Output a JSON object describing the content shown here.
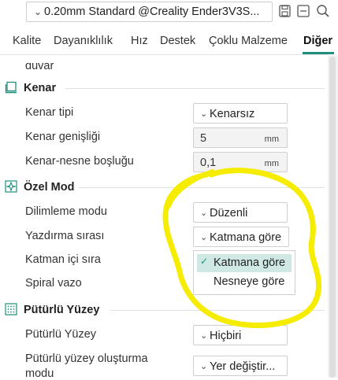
{
  "profile": {
    "preset": "0.20mm Standard @Creality Ender3V3S..."
  },
  "icons": {
    "save": "save-icon",
    "compare": "compare-icon",
    "search": "search-icon",
    "edge": "edge-section-icon",
    "special": "special-mode-icon",
    "fuzzy": "fuzzy-skin-icon"
  },
  "tabs": [
    {
      "label": "Kalite"
    },
    {
      "label": "Dayanıklılık"
    },
    {
      "label": "Hız"
    },
    {
      "label": "Destek"
    },
    {
      "label": "Çoklu Malzeme"
    },
    {
      "label": "Diğer",
      "active": true
    }
  ],
  "cutoff_label": "duvar",
  "sections": {
    "edge": {
      "title": "Kenar",
      "rows": [
        {
          "label": "Kenar tipi",
          "value": "Kenarsız"
        },
        {
          "label": "Kenar genişliği",
          "value": "5",
          "unit": "mm"
        },
        {
          "label": "Kenar-nesne boşluğu",
          "value": "0,1",
          "unit": "mm"
        }
      ]
    },
    "special": {
      "title": "Özel Mod",
      "rows": [
        {
          "label": "Dilimleme modu",
          "value": "Düzenli"
        },
        {
          "label": "Yazdırma sırası",
          "value": "Katmana göre"
        },
        {
          "label": "Katman içi sıra"
        },
        {
          "label": "Spiral vazo"
        }
      ],
      "dropdown_options": [
        {
          "label": "Katmana göre",
          "selected": true
        },
        {
          "label": "Nesneye göre"
        }
      ]
    },
    "fuzzy": {
      "title": "Pütürlü Yüzey",
      "rows": [
        {
          "label": "Pütürlü Yüzey",
          "value": "Hiçbiri"
        },
        {
          "label_line1": "Pütürlü yüzey oluşturma",
          "label_line2": "modu",
          "value": "Yer değiştir..."
        }
      ]
    }
  },
  "colors": {
    "accent": "#1f8f7d",
    "annotation": "#f5ec00"
  }
}
